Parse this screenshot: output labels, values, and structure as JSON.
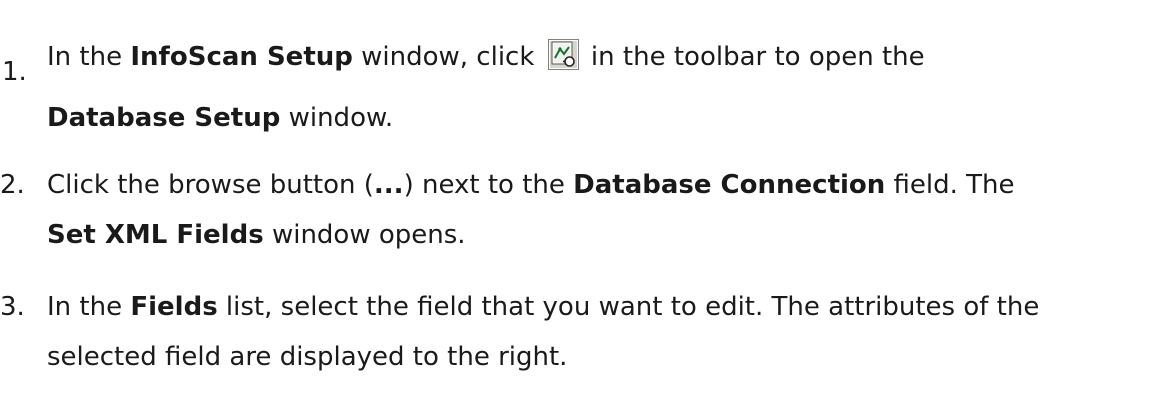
{
  "steps": [
    {
      "number": "1.",
      "line1_a": "In the ",
      "line1_b": "InfoScan Setup",
      "line1_c": " window, click ",
      "line1_d": " in the toolbar to open the",
      "line2_a": "Database Setup",
      "line2_b": " window."
    },
    {
      "number": "2.",
      "line1_a": "Click the browse button (",
      "line1_b": "...",
      "line1_c": ") next to the ",
      "line1_d": "Database Connection",
      "line1_e": " field. The",
      "line2_a": "Set XML Fields",
      "line2_b": " window opens."
    },
    {
      "number": "3.",
      "line1_a": "In the ",
      "line1_b": "Fields",
      "line1_c": " list, select the field that you want to edit. The attributes of the",
      "line2_a": "selected field are displayed to the right."
    }
  ],
  "icons": {
    "toolbar_button": "database-setup-icon"
  }
}
